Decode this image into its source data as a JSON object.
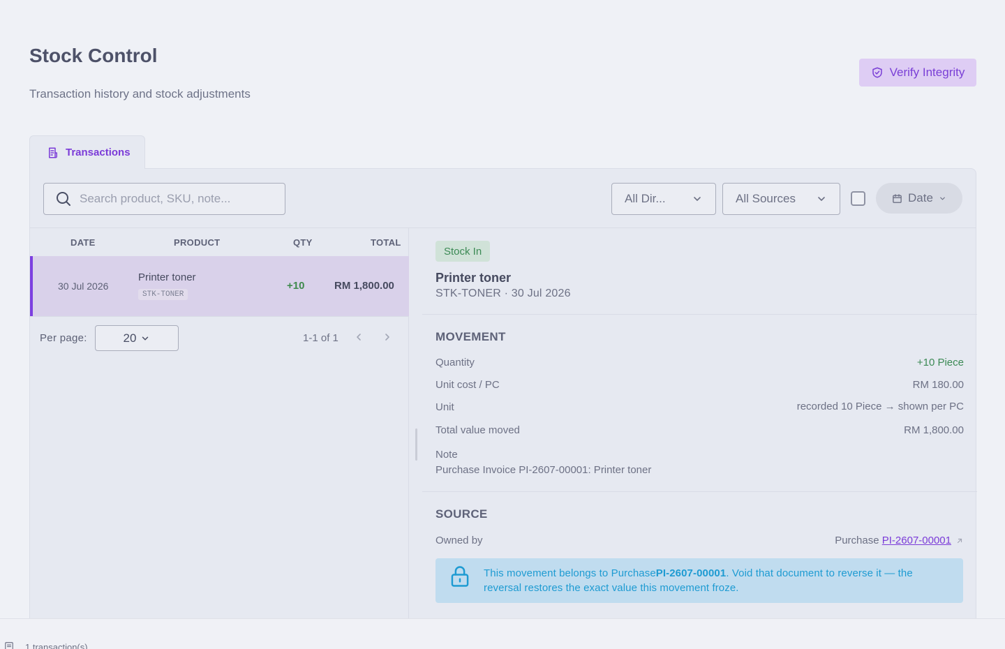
{
  "header": {
    "title": "Stock Control",
    "subtitle": "Transaction history and stock adjustments",
    "verify_label": "Verify Integrity"
  },
  "tabs": [
    {
      "label": "Transactions"
    }
  ],
  "filters": {
    "search_placeholder": "Search product, SKU, note...",
    "direction": "All Dir...",
    "source": "All Sources",
    "date": "Date"
  },
  "table": {
    "columns": [
      "DATE",
      "PRODUCT",
      "QTY",
      "TOTAL"
    ],
    "rows": [
      {
        "date": "30 Jul 2026",
        "product": "Printer toner",
        "sku": "STK-TONER",
        "qty": "+10",
        "total": "RM 1,800.00"
      }
    ]
  },
  "pagination": {
    "per_page_label": "Per page:",
    "per_page": "20",
    "range": "1-1 of 1"
  },
  "detail": {
    "badge": "Stock In",
    "badge_color": "#3c8a55",
    "title": "Printer toner",
    "subtitle": "STK-TONER · 30 Jul 2026",
    "movement_title": "MOVEMENT",
    "movement": [
      {
        "label": "Quantity",
        "value": "+10 Piece"
      },
      {
        "label": "Unit cost / PC",
        "value": "RM 180.00"
      },
      {
        "label": "Unit",
        "value": "recorded 10 Piece → shown per PC"
      },
      {
        "label": "Total value moved",
        "value": "RM 1,800.00"
      }
    ],
    "note_label": "Note",
    "note": "Purchase Invoice PI-2607-00001: Printer toner",
    "source_title": "SOURCE",
    "owned_by_label": "Owned by",
    "owned_by_prefix": "Purchase",
    "owned_by_link": "PI-2607-00001",
    "info_prefix": "This movement belongs to Purchase",
    "info_doc": "PI-2607-00001",
    "info_suffix": ". Void that document to reverse it — the reversal restores the exact value this movement froze."
  },
  "footer": {
    "count_text": "1 transaction(s)"
  },
  "colors": {
    "accent": "#7b3bd8",
    "positive": "#3c8a55",
    "info": "#1e9bd2"
  }
}
